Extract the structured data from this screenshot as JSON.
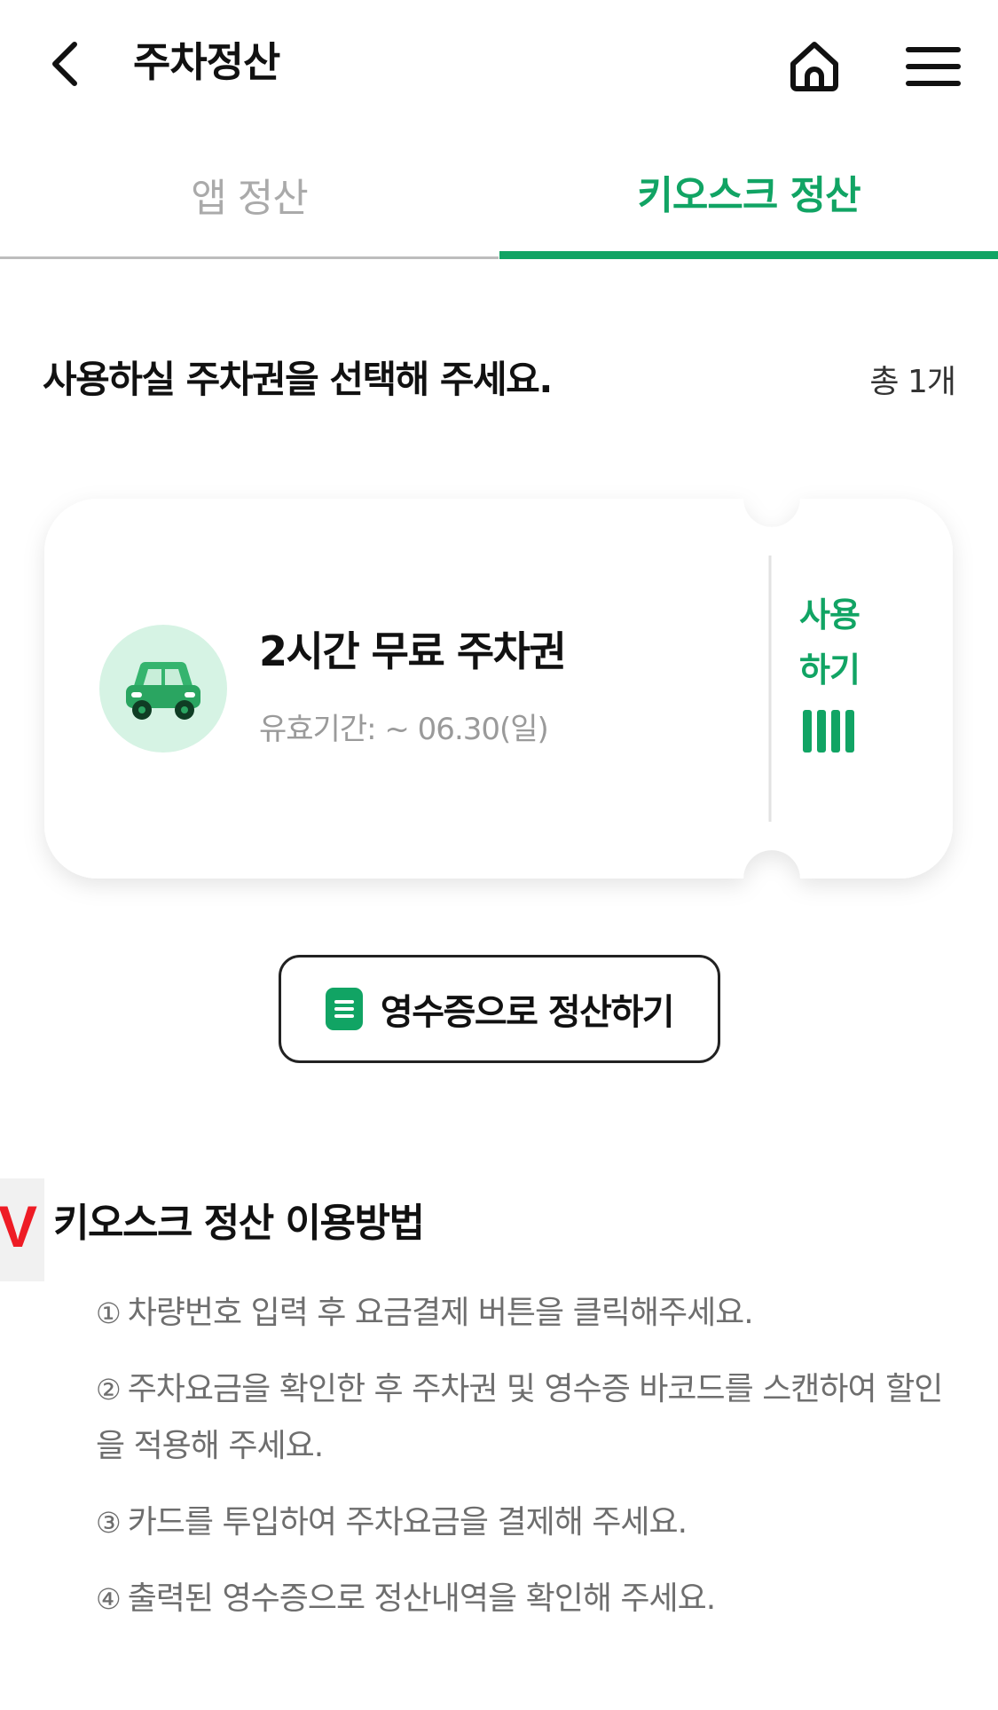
{
  "header": {
    "title": "주차정산",
    "back_icon": "chevron-left-icon",
    "home_icon": "home-icon",
    "menu_icon": "hamburger-menu-icon"
  },
  "tabs": [
    {
      "label": "앱 정산",
      "active": false
    },
    {
      "label": "키오스크 정산",
      "active": true
    }
  ],
  "accent_color": "#11a464",
  "section": {
    "title": "사용하실 주차권을 선택해 주세요.",
    "count": "총 1개"
  },
  "ticket": {
    "icon": "car-icon",
    "name": "2시간 무료 주차권",
    "validity": "유효기간: ~ 06.30(일)",
    "use_line1": "사용",
    "use_line2": "하기",
    "use_icon": "barcode-icon"
  },
  "receipt_button": {
    "icon": "receipt-icon",
    "label": "영수증으로 정산하기"
  },
  "guide": {
    "badge": "V",
    "title": "키오스크 정산 이용방법",
    "steps": [
      {
        "num": "①",
        "text": "차량번호 입력 후 요금결제 버튼을 클릭해주세요."
      },
      {
        "num": "②",
        "text": "주차요금을 확인한 후 주차권 및 영수증 바코드를 스캔하여 할인을 적용해 주세요."
      },
      {
        "num": "③",
        "text": "카드를 투입하여 주차요금을 결제해 주세요."
      },
      {
        "num": "④",
        "text": "출력된 영수증으로 정산내역을 확인해 주세요."
      }
    ]
  }
}
